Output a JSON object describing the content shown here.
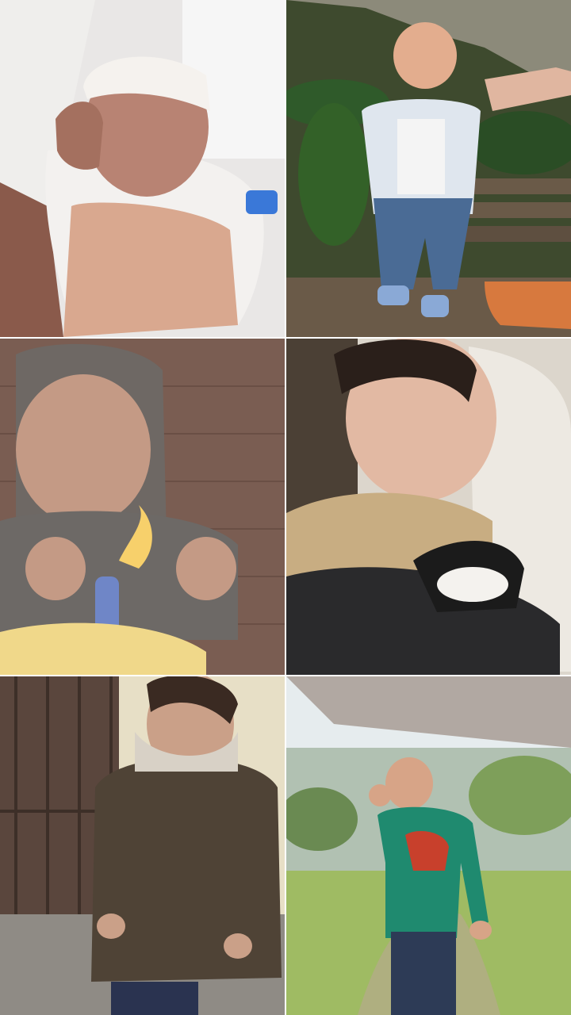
{
  "collage": {
    "photos": [
      {
        "subject": "newborn-in-hospital",
        "palette": {
          "bg": "#e9e7e6",
          "blanket": "#f3f1ef",
          "skin": "#b88373",
          "hand": "#d9a88f"
        }
      },
      {
        "subject": "toddler-standing-on-bench",
        "palette": {
          "bg": "#3e4a2e",
          "leaf": "#2f5a2a",
          "wood": "#6a5a48",
          "jeans": "#4a6b95",
          "vest": "#dfe6ee",
          "pot": "#d7793e"
        }
      },
      {
        "subject": "child-with-birthday-candle",
        "palette": {
          "bg": "#7a5d52",
          "skin": "#c49a85",
          "hood": "#6e6864",
          "flame": "#ffd66b",
          "cake": "#f0d88a",
          "candle": "#6f86c7"
        }
      },
      {
        "subject": "child-holding-cat",
        "palette": {
          "bg": "#dcd6cc",
          "skin": "#e2b9a3",
          "sweater": "#c8ad82",
          "shirt": "#2a2a2c",
          "cat": "#1b1b1b"
        }
      },
      {
        "subject": "boy-in-puffer-jacket",
        "palette": {
          "bg": "#e7dfc6",
          "door": "#5a463d",
          "jacket": "#4f4336",
          "ground": "#8f8b85",
          "skin": "#caa088"
        }
      },
      {
        "subject": "boy-in-green-hoodie-garden",
        "palette": {
          "sky": "#e6ecee",
          "grass": "#9fbb63",
          "hoodie": "#1f8a6f",
          "jeans": "#2d3b56",
          "skin": "#d7a487"
        }
      }
    ]
  }
}
